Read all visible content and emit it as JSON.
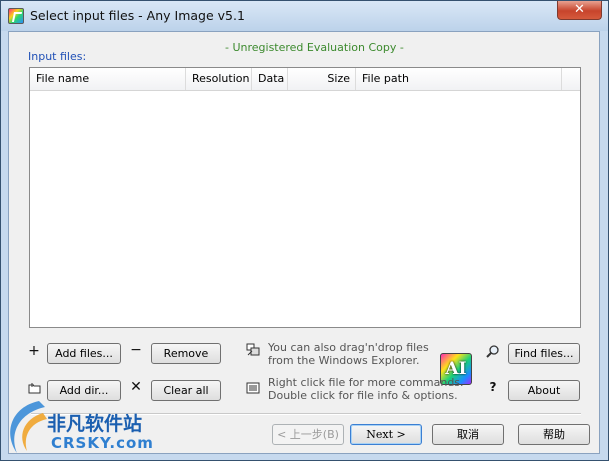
{
  "window": {
    "title": "Select input files - Any Image v5.1",
    "close_label": "✕"
  },
  "eval_notice": "- Unregistered Evaluation Copy -",
  "input_files_label": "Input files:",
  "columns": [
    "File name",
    "Resolution",
    "Data",
    "Size",
    "File path"
  ],
  "buttons": {
    "add_files": "Add files...",
    "remove": "Remove",
    "find_files": "Find files...",
    "add_dir": "Add dir...",
    "clear_all": "Clear all",
    "about": "About",
    "back": "< 上一步(B)",
    "next": "Next >",
    "cancel": "取消",
    "help": "帮助"
  },
  "glyphs": {
    "plus": "+",
    "minus": "−",
    "cross": "✕",
    "question": "?"
  },
  "hints": {
    "dragdrop_line1": "You can also drag'n'drop files",
    "dragdrop_line2": "from the Windows Explorer.",
    "commands_line1": "Right click file for more commands.",
    "commands_line2": "Double click for file info & options."
  },
  "logo_text": "AI",
  "watermark": {
    "brand": "非凡软件站",
    "site": "CRSKY.com"
  }
}
